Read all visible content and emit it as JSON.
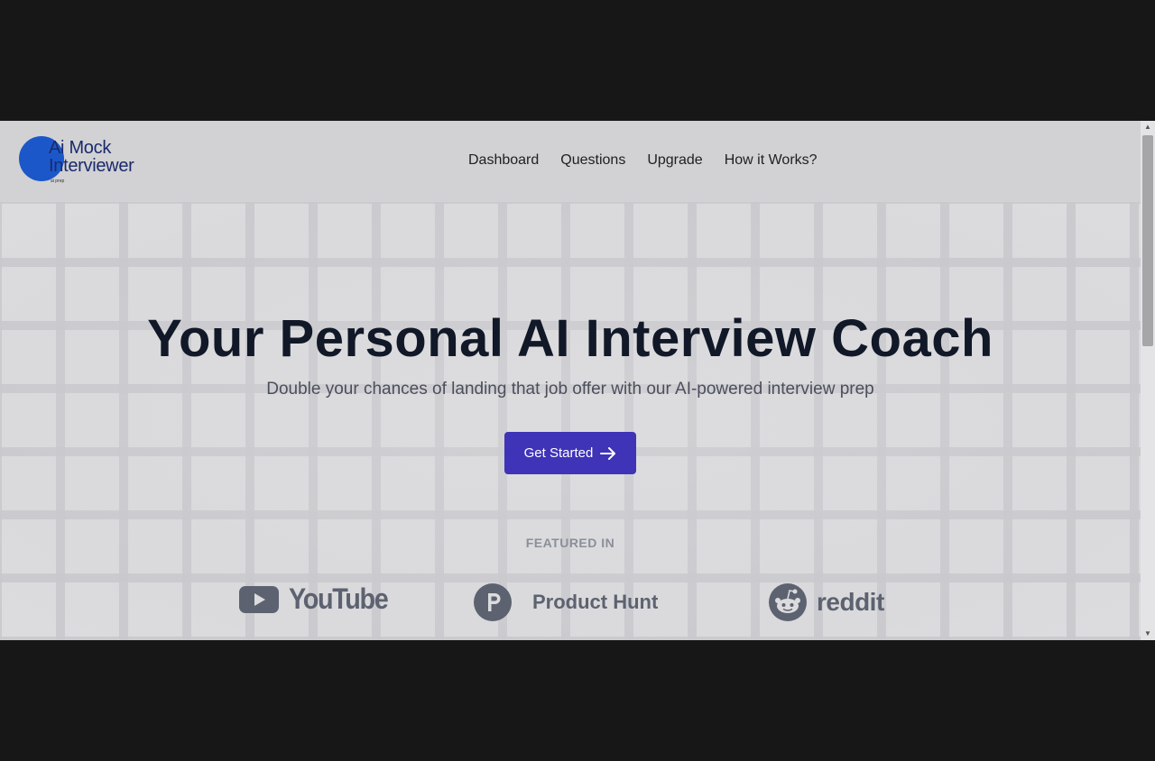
{
  "logo": {
    "line1": "Ai Mock",
    "line2": "Interviewer",
    "tagline": "ai prep"
  },
  "nav": {
    "items": [
      "Dashboard",
      "Questions",
      "Upgrade",
      "How it Works?"
    ]
  },
  "hero": {
    "title": "Your Personal AI Interview Coach",
    "subtitle": "Double your chances of landing that job offer with our AI-powered interview prep",
    "cta_label": "Get Started"
  },
  "featured": {
    "label": "FEATURED IN",
    "brands": [
      {
        "name": "YouTube",
        "icon": "youtube-icon"
      },
      {
        "name": "Product Hunt",
        "icon": "product-hunt-icon"
      },
      {
        "name": "reddit",
        "icon": "reddit-icon"
      }
    ]
  },
  "colors": {
    "accent": "#3f33b8",
    "logo_blue": "#1b57c9",
    "title": "#111827",
    "brand_gray": "#5d6270"
  }
}
